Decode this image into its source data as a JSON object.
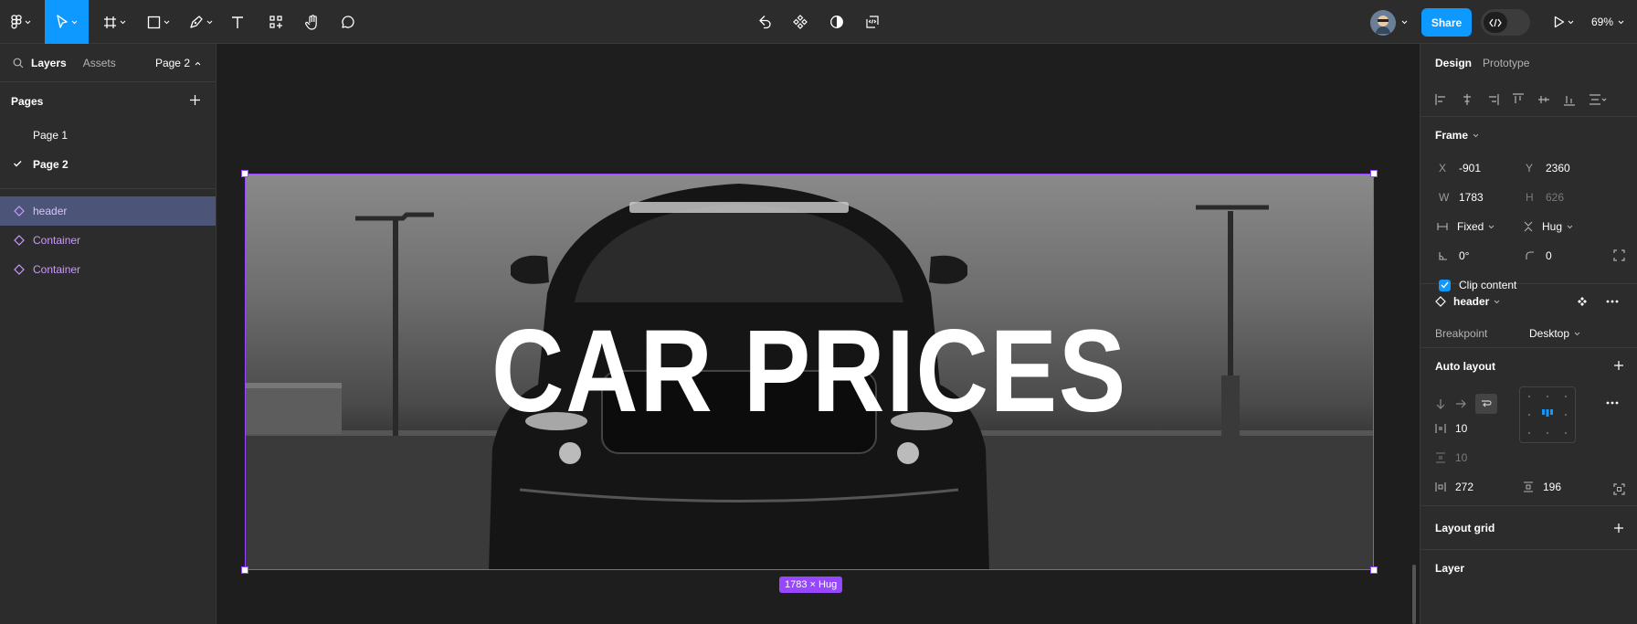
{
  "toolbar": {
    "share_label": "Share",
    "zoom": "69%"
  },
  "left_panel": {
    "tabs": [
      "Layers",
      "Assets"
    ],
    "current_page_label": "Page 2",
    "pages_title": "Pages",
    "pages": [
      "Page 1",
      "Page 2"
    ],
    "layers": [
      "header",
      "Container",
      "Container"
    ]
  },
  "canvas": {
    "frame_title": "CAR PRICES",
    "size_tag": "1783 × Hug"
  },
  "right_panel": {
    "tabs": [
      "Design",
      "Prototype"
    ],
    "frame_section": "Frame",
    "x_label": "X",
    "x_value": "-901",
    "y_label": "Y",
    "y_value": "2360",
    "w_label": "W",
    "w_value": "1783",
    "h_label": "H",
    "h_value": "626",
    "width_mode": "Fixed",
    "height_mode": "Hug",
    "rotation": "0°",
    "radius": "0",
    "clip_content": "Clip content",
    "component_name": "header",
    "breakpoint_label": "Breakpoint",
    "breakpoint_value": "Desktop",
    "auto_layout_title": "Auto layout",
    "gap": "10",
    "gap_vertical": "10",
    "padding_h": "272",
    "padding_v": "196",
    "layout_grid_title": "Layout grid",
    "layer_title": "Layer"
  },
  "colors": {
    "accent": "#0d99ff",
    "selection": "#9747ff",
    "component": "#c79bff",
    "panel": "#2c2c2c",
    "canvas": "#1e1e1e"
  }
}
